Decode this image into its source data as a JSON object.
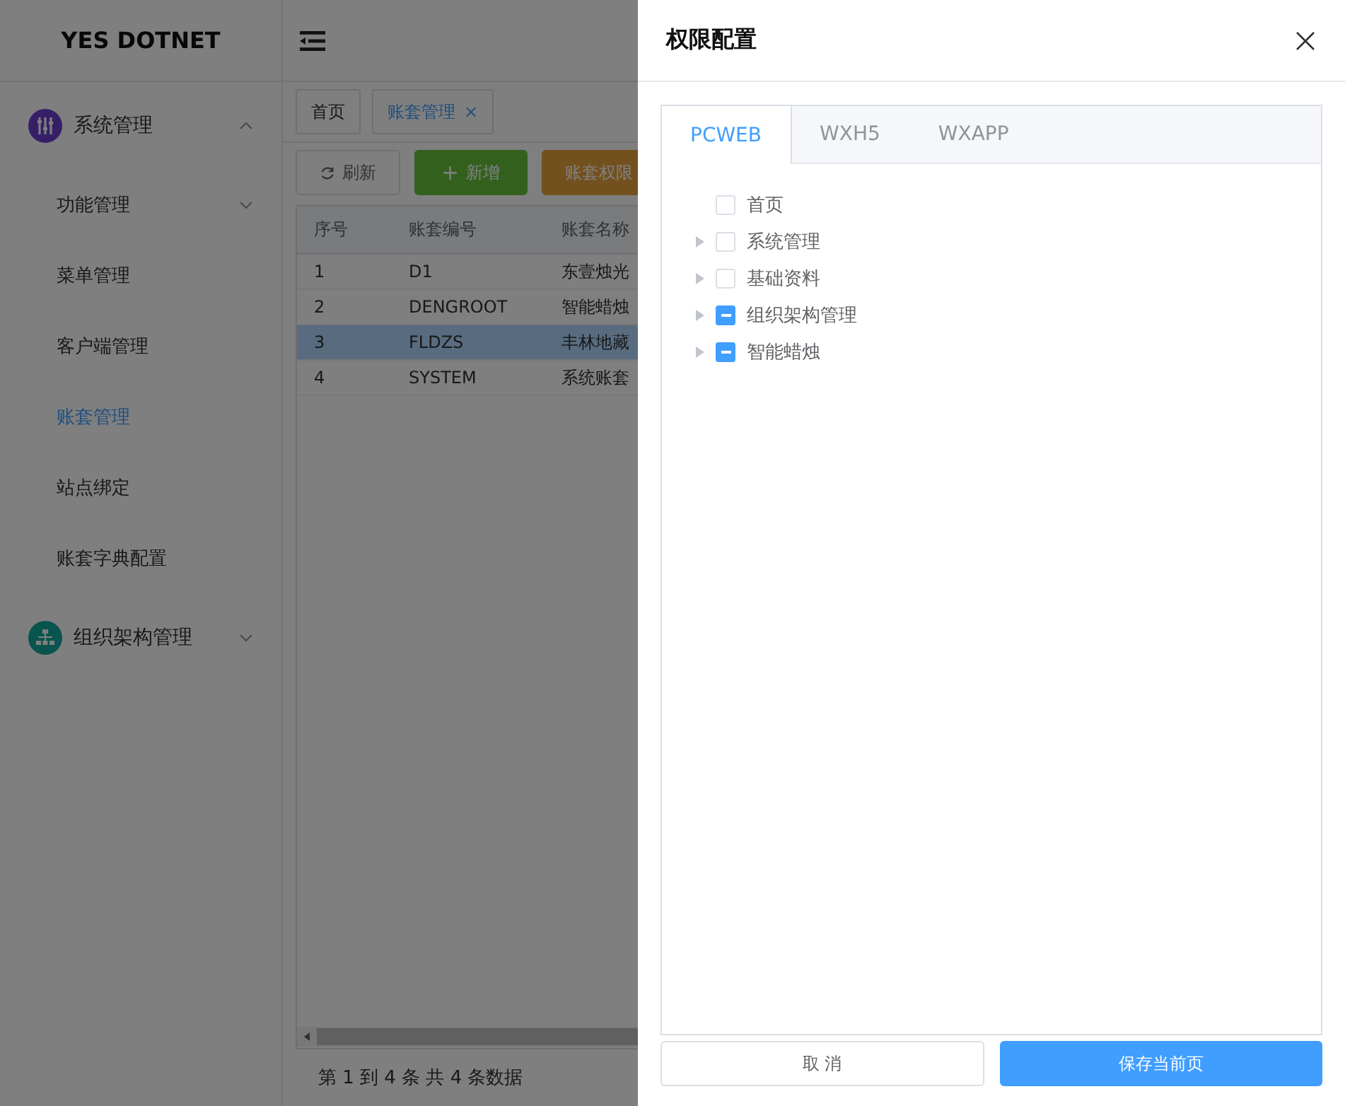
{
  "brand": "YES DOTNET",
  "sidebar": {
    "items": [
      {
        "label": "系统管理",
        "expanded": true,
        "selected": false,
        "children": [
          {
            "label": "功能管理",
            "expandable": true,
            "selected": false
          },
          {
            "label": "菜单管理",
            "expandable": false,
            "selected": false
          },
          {
            "label": "客户端管理",
            "expandable": false,
            "selected": false
          },
          {
            "label": "账套管理",
            "expandable": false,
            "selected": true
          },
          {
            "label": "站点绑定",
            "expandable": false,
            "selected": false
          },
          {
            "label": "账套字典配置",
            "expandable": false,
            "selected": false
          }
        ]
      },
      {
        "label": "组织架构管理",
        "expanded": false,
        "selected": false
      }
    ]
  },
  "page_tabs": [
    {
      "label": "首页",
      "selected": false,
      "closable": false
    },
    {
      "label": "账套管理",
      "selected": true,
      "closable": true,
      "close": "×"
    }
  ],
  "toolbar": [
    {
      "label": "刷新",
      "kind": "refresh"
    },
    {
      "label": "新增",
      "kind": "add",
      "icon": "+"
    },
    {
      "label": "账套权限",
      "kind": "warning"
    }
  ],
  "table": {
    "columns": [
      "序号",
      "账套编号",
      "账套名称"
    ],
    "rows": [
      {
        "cells": [
          "1",
          "D1",
          "东壹烛光"
        ],
        "selected": false
      },
      {
        "cells": [
          "2",
          "DENGROOT",
          "智能蜡烛"
        ],
        "selected": false
      },
      {
        "cells": [
          "3",
          "FLDZS",
          "丰林地藏"
        ],
        "selected": true
      },
      {
        "cells": [
          "4",
          "SYSTEM",
          "系统账套"
        ],
        "selected": false
      }
    ]
  },
  "pagination": "第 1 到 4 条 共 4 条数据",
  "drawer": {
    "title": "权限配置",
    "tabs": [
      {
        "label": "PCWEB",
        "selected": true
      },
      {
        "label": "WXH5",
        "selected": false
      },
      {
        "label": "WXAPP",
        "selected": false
      }
    ],
    "tree": [
      {
        "label": "首页",
        "indeterminate": false
      },
      {
        "label": "系统管理",
        "expanded": false,
        "indeterminate": false
      },
      {
        "label": "基础资料",
        "expanded": false,
        "indeterminate": false
      },
      {
        "label": "组织架构管理",
        "expanded": false,
        "indeterminate": true
      },
      {
        "label": "智能蜡烛",
        "expanded": false,
        "indeterminate": true
      }
    ],
    "buttons": [
      {
        "label": "取 消",
        "kind": "plain"
      },
      {
        "label": "保存当前页",
        "kind": "primary"
      }
    ]
  }
}
